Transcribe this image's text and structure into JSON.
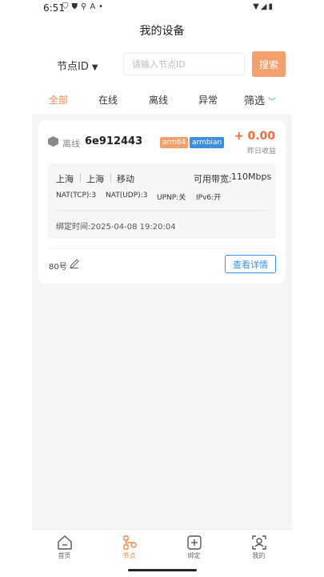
{
  "status_bar": {
    "time": "6:51",
    "left_icons": [
      "shield-icon",
      "shield-check-icon",
      "usb-icon",
      "font-icon",
      "dot-icon"
    ],
    "right_icons": [
      "wifi-icon",
      "signal-icon",
      "battery-icon"
    ]
  },
  "header": {
    "title": "我的设备"
  },
  "search": {
    "node_select_label": "节点ID",
    "placeholder": "请输入节点ID",
    "button_label": "搜索"
  },
  "tabs": [
    {
      "label": "全部",
      "active": true
    },
    {
      "label": "在线",
      "active": false
    },
    {
      "label": "离线",
      "active": false
    },
    {
      "label": "异常",
      "active": false
    }
  ],
  "filter_label": "筛选",
  "device": {
    "status": "离线",
    "id": "6e912443",
    "arch_tag": "arm64",
    "os_tag": "armbian",
    "earnings_value": "+ 0.00",
    "earnings_label": "昨日收益",
    "location": [
      "上海",
      "上海",
      "移动"
    ],
    "bandwidth_label": "可用带宽:",
    "bandwidth_value": "110Mbps",
    "nat_tcp": "NAT(TCP):3",
    "nat_udp": "NAT(UDP):3",
    "upnp": "UPNP:关",
    "ipv6": "IPv6:开",
    "bind_time_label": "绑定时间:",
    "bind_time_value": "2025-04-08 19:20:04",
    "alias": "80号",
    "detail_button": "查看详情"
  },
  "colors": {
    "accent_orange": "#f28a4a",
    "accent_blue": "#3a8fe0",
    "earnings_red": "#f06a3a"
  },
  "bottom_nav": [
    {
      "label": "首页",
      "icon": "home-icon",
      "active": false
    },
    {
      "label": "节点",
      "icon": "nodes-icon",
      "active": true
    },
    {
      "label": "绑定",
      "icon": "add-square-icon",
      "active": false
    },
    {
      "label": "我的",
      "icon": "profile-icon",
      "active": false
    }
  ]
}
